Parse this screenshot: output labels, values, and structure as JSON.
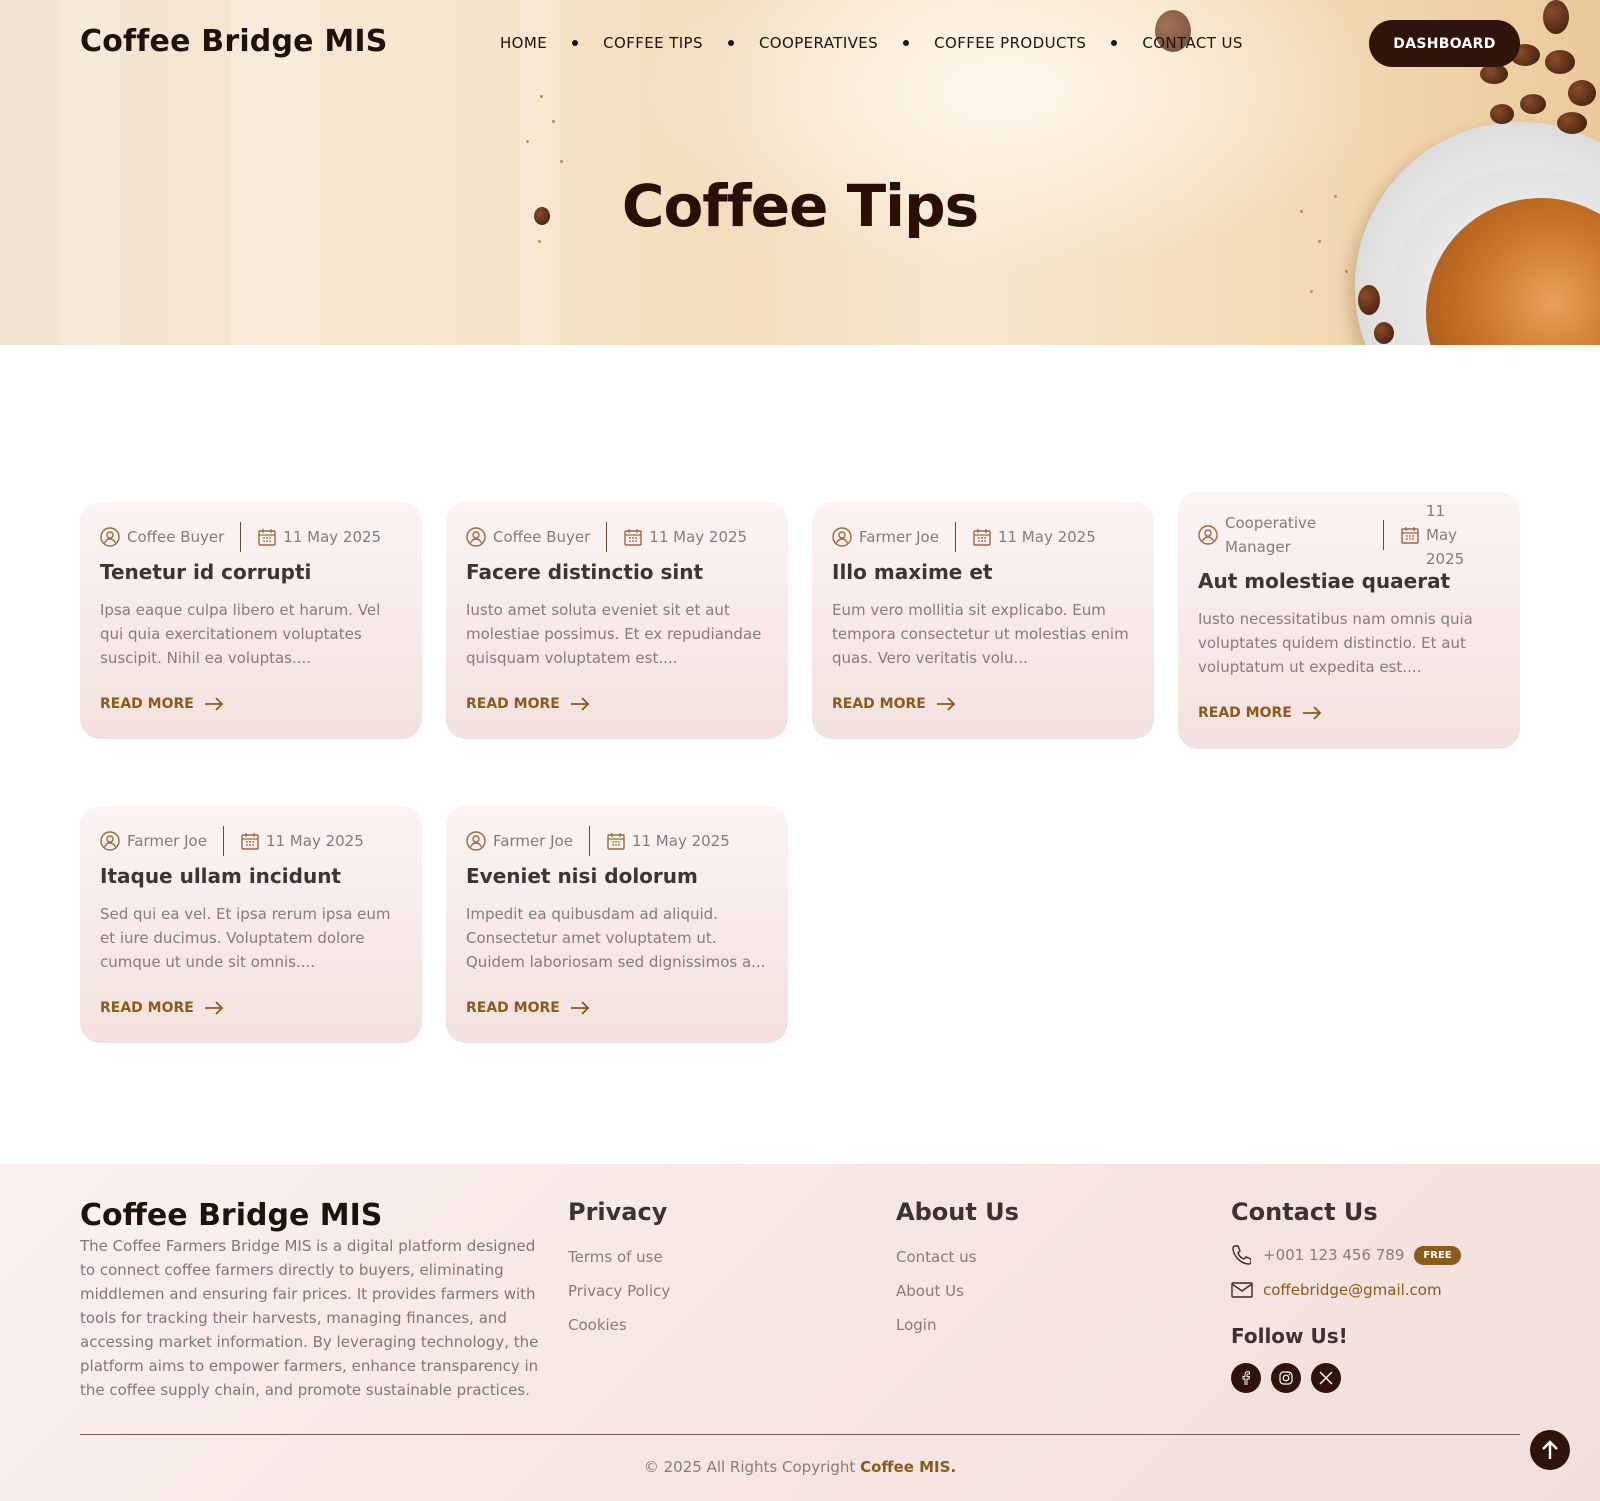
{
  "header": {
    "brand": "Coffee Bridge MIS",
    "nav": [
      "HOME",
      "COFFEE TIPS",
      "COOPERATIVES",
      "COFFEE PRODUCTS",
      "CONTACT US"
    ],
    "dashboard_label": "DASHBOARD"
  },
  "hero": {
    "title": "Coffee Tips"
  },
  "posts": [
    {
      "author": "Coffee Buyer",
      "date": "11 May 2025",
      "title": "Tenetur id corrupti",
      "excerpt": "Ipsa eaque culpa libero et harum. Vel qui quia exercitationem voluptates suscipit. Nihil ea voluptas....",
      "read_more": "READ MORE"
    },
    {
      "author": "Coffee Buyer",
      "date": "11 May 2025",
      "title": "Facere distinctio sint",
      "excerpt": "Iusto amet soluta eveniet sit et aut molestiae possimus. Et ex repudiandae quisquam voluptatem est....",
      "read_more": "READ MORE"
    },
    {
      "author": "Farmer Joe",
      "date": "11 May 2025",
      "title": "Illo maxime et",
      "excerpt": "Eum vero mollitia sit explicabo. Eum tempora consectetur ut molestias enim quas. Vero veritatis volu...",
      "read_more": "READ MORE"
    },
    {
      "author": "Cooperative Manager",
      "date": "11 May 2025",
      "title": "Aut molestiae quaerat",
      "excerpt": "Iusto necessitatibus nam omnis quia voluptates quidem distinctio. Et aut voluptatum ut expedita est....",
      "read_more": "READ MORE"
    },
    {
      "author": "Farmer Joe",
      "date": "11 May 2025",
      "title": "Itaque ullam incidunt",
      "excerpt": "Sed qui ea vel. Et ipsa rerum ipsa eum et iure ducimus. Voluptatem dolore cumque ut unde sit omnis....",
      "read_more": "READ MORE"
    },
    {
      "author": "Farmer Joe",
      "date": "11 May 2025",
      "title": "Eveniet nisi dolorum",
      "excerpt": "Impedit ea quibusdam ad aliquid. Consectetur amet voluptatem ut. Quidem laboriosam sed dignissimos a...",
      "read_more": "READ MORE"
    }
  ],
  "footer": {
    "brand": "Coffee Bridge MIS",
    "description": "The Coffee Farmers Bridge MIS is a digital platform designed to connect coffee farmers directly to buyers, eliminating middlemen and ensuring fair prices. It provides farmers with tools for tracking their harvests, managing finances, and accessing market information. By leveraging technology, the platform aims to empower farmers, enhance transparency in the coffee supply chain, and promote sustainable practices.",
    "privacy": {
      "heading": "Privacy",
      "links": [
        "Terms of use",
        "Privacy Policy",
        "Cookies"
      ]
    },
    "about": {
      "heading": "About Us",
      "links": [
        "Contact us",
        "About Us",
        "Login"
      ]
    },
    "contact": {
      "heading": "Contact Us",
      "phone": "+001 123 456 789",
      "badge": "FREE",
      "email": "coffebridge@gmail.com"
    },
    "follow": {
      "heading": "Follow Us!",
      "icons": [
        "facebook-icon",
        "instagram-icon",
        "x-icon"
      ]
    },
    "copyright_prefix": "© 2025 All Rights Copyright",
    "copyright_brand": "Coffee MIS."
  },
  "colors": {
    "primary_dark": "#2e140b",
    "accent": "#8c5a1c",
    "card_bg": "#f6e9e7"
  }
}
